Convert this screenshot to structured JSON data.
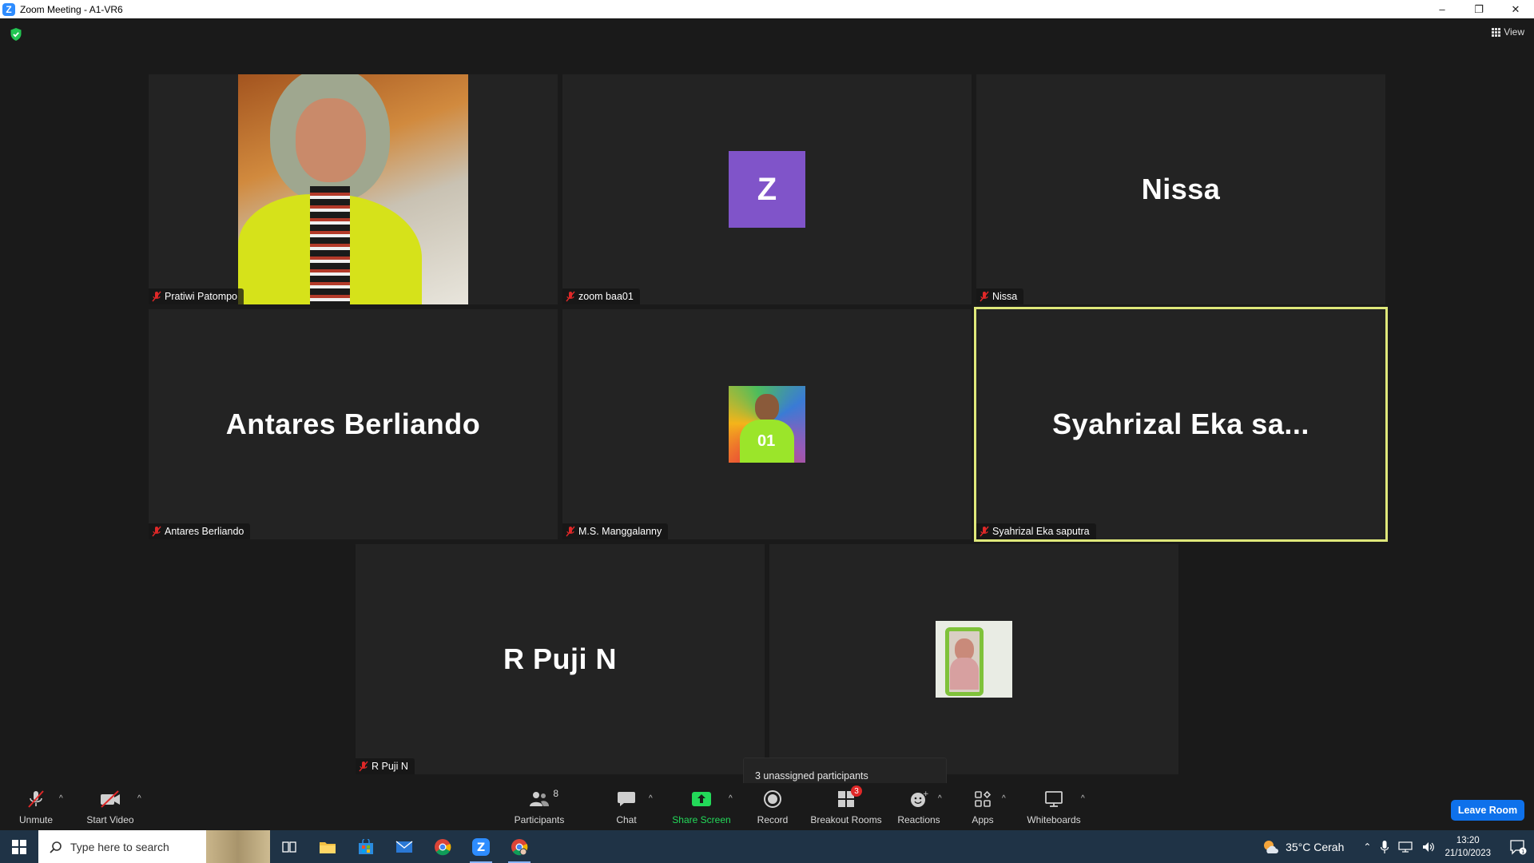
{
  "window": {
    "title": "Zoom Meeting - A1-VR6",
    "logo_letter": "Z",
    "minimize": "–",
    "restore": "❐",
    "close": "✕"
  },
  "meeting": {
    "view_label": "View",
    "tiles": [
      {
        "label": "Pratiwi Patompo",
        "type": "video"
      },
      {
        "label": "zoom baa01",
        "type": "letter",
        "letter": "Z",
        "color": "#8054c9"
      },
      {
        "label": "Nissa",
        "type": "name",
        "display": "Nissa"
      },
      {
        "label": "Antares Berliando",
        "type": "name",
        "display": "Antares Berliando"
      },
      {
        "label": "M.S. Manggalanny",
        "type": "photo"
      },
      {
        "label": "Syahrizal Eka saputra",
        "type": "name",
        "display": "Syahrizal  Eka  sa...",
        "active": true
      },
      {
        "label": "R Puji N",
        "type": "name",
        "display": "R Puji N"
      },
      {
        "label": "",
        "type": "photo"
      }
    ],
    "tooltip": "3 unassigned participants"
  },
  "toolbar": {
    "unmute": "Unmute",
    "start_video": "Start Video",
    "participants": "Participants",
    "participants_count": "8",
    "chat": "Chat",
    "share_screen": "Share Screen",
    "record": "Record",
    "breakout_rooms": "Breakout Rooms",
    "breakout_badge": "3",
    "reactions": "Reactions",
    "apps": "Apps",
    "whiteboards": "Whiteboards",
    "leave": "Leave Room",
    "caret": "^"
  },
  "taskbar": {
    "search_placeholder": "Type here to search",
    "weather": "35°C  Cerah",
    "time": "13:20",
    "date": "21/10/2023",
    "notif_count": "1"
  },
  "colors": {
    "accent_blue": "#0e71eb",
    "active_speaker": "#dfe87a",
    "share_green": "#23d959",
    "avatar_purple": "#8054c9"
  }
}
